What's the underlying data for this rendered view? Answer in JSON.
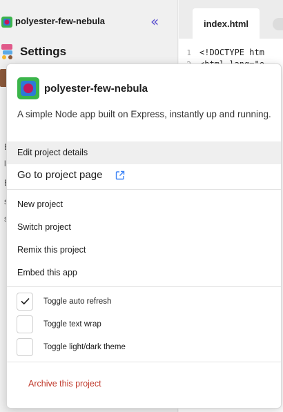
{
  "sidebar": {
    "project_name": "polyester-few-nebula",
    "collapse_glyph": "«",
    "settings_label": "Settings",
    "fragments": [
      "E",
      "l",
      "E",
      "s",
      "s"
    ]
  },
  "editor": {
    "tab_label": "index.html",
    "lines": [
      {
        "num": "1",
        "text": "<!DOCTYPE htm"
      },
      {
        "num": "2",
        "text": "<html lang=\"e"
      }
    ]
  },
  "menu": {
    "project_name": "polyester-few-nebula",
    "description": "A simple Node app built on Express, instantly up and running.",
    "edit_details": "Edit project details",
    "go_to_project": "Go to project page",
    "new_project": "New project",
    "switch_project": "Switch project",
    "remix_project": "Remix this project",
    "embed_app": "Embed this app",
    "toggles": [
      {
        "label": "Toggle auto refresh",
        "checked": true
      },
      {
        "label": "Toggle text wrap",
        "checked": false
      },
      {
        "label": "Toggle light/dark theme",
        "checked": false
      }
    ],
    "archive": "Archive this project"
  },
  "colors": {
    "accent": "#5a4fcf",
    "danger": "#c0392b",
    "logo_green": "#3bb54a",
    "logo_magenta": "#c2185b",
    "highlight": "#efefef"
  }
}
